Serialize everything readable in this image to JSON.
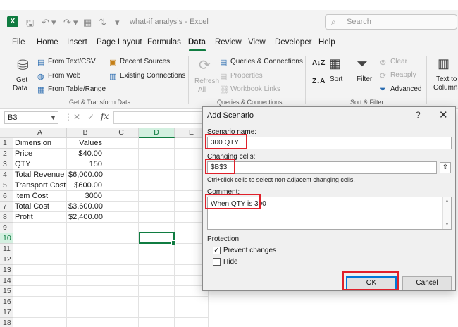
{
  "titlebar": {
    "logo": "X",
    "doc_title": "what-if analysis  -  Excel",
    "search_placeholder": "Search"
  },
  "menu": {
    "tabs": [
      "File",
      "Home",
      "Insert",
      "Page Layout",
      "Formulas",
      "Data",
      "Review",
      "View",
      "Developer",
      "Help"
    ],
    "active": "Data"
  },
  "ribbon": {
    "get_data_label_1": "Get",
    "get_data_label_2": "Data",
    "from_text_csv": "From Text/CSV",
    "from_web": "From Web",
    "from_table_range": "From Table/Range",
    "recent_sources": "Recent Sources",
    "existing_connections": "Existing Connections",
    "group_get_transform": "Get & Transform Data",
    "refresh_all_1": "Refresh",
    "refresh_all_2": "All",
    "queries_connections": "Queries & Connections",
    "properties": "Properties",
    "workbook_links": "Workbook Links",
    "group_queries": "Queries & Connections",
    "sort": "Sort",
    "filter": "Filter",
    "clear": "Clear",
    "reapply": "Reapply",
    "advanced": "Advanced",
    "group_sort_filter": "Sort & Filter",
    "text_to_columns_1": "Text to",
    "text_to_columns_2": "Columns"
  },
  "formula_bar": {
    "name_box": "B3",
    "fx": "fx",
    "value": ""
  },
  "sheet": {
    "columns": [
      "A",
      "B",
      "C",
      "D",
      "E"
    ],
    "selected_column": "D",
    "selected_row": "10",
    "rows": [
      {
        "n": "1",
        "a": "Dimension",
        "b": "Values"
      },
      {
        "n": "2",
        "a": "Price",
        "b": "$40.00"
      },
      {
        "n": "3",
        "a": "QTY",
        "b": "150"
      },
      {
        "n": "4",
        "a": "Total Revenue",
        "b": "$6,000.00"
      },
      {
        "n": "5",
        "a": "Transport Cost",
        "b": "$600.00"
      },
      {
        "n": "6",
        "a": "Item Cost",
        "b": "3000"
      },
      {
        "n": "7",
        "a": "Total Cost",
        "b": "$3,600.00"
      },
      {
        "n": "8",
        "a": "Profit",
        "b": "$2,400.00"
      },
      {
        "n": "9",
        "a": "",
        "b": ""
      },
      {
        "n": "10",
        "a": "",
        "b": ""
      },
      {
        "n": "11",
        "a": "",
        "b": ""
      },
      {
        "n": "12",
        "a": "",
        "b": ""
      },
      {
        "n": "13",
        "a": "",
        "b": ""
      },
      {
        "n": "14",
        "a": "",
        "b": ""
      },
      {
        "n": "15",
        "a": "",
        "b": ""
      },
      {
        "n": "16",
        "a": "",
        "b": ""
      },
      {
        "n": "17",
        "a": "",
        "b": ""
      },
      {
        "n": "18",
        "a": "",
        "b": ""
      }
    ]
  },
  "dialog": {
    "title": "Add Scenario",
    "help": "?",
    "close": "✕",
    "scenario_name_label": "Scenario name:",
    "scenario_name_value": "300 QTY",
    "changing_cells_label": "Changing cells:",
    "changing_cells_value": "$B$3",
    "hint": "Ctrl+click cells to select non-adjacent changing cells.",
    "comment_label": "Comment:",
    "comment_value": "When QTY is 300",
    "protection_label": "Protection",
    "prevent_changes_label": "Prevent changes",
    "prevent_changes_checked": true,
    "hide_label": "Hide",
    "hide_checked": false,
    "ok_label": "OK",
    "cancel_label": "Cancel"
  },
  "colors": {
    "excel_green": "#107c41",
    "highlight_red": "#e0202a",
    "ok_blue": "#0078d7"
  }
}
